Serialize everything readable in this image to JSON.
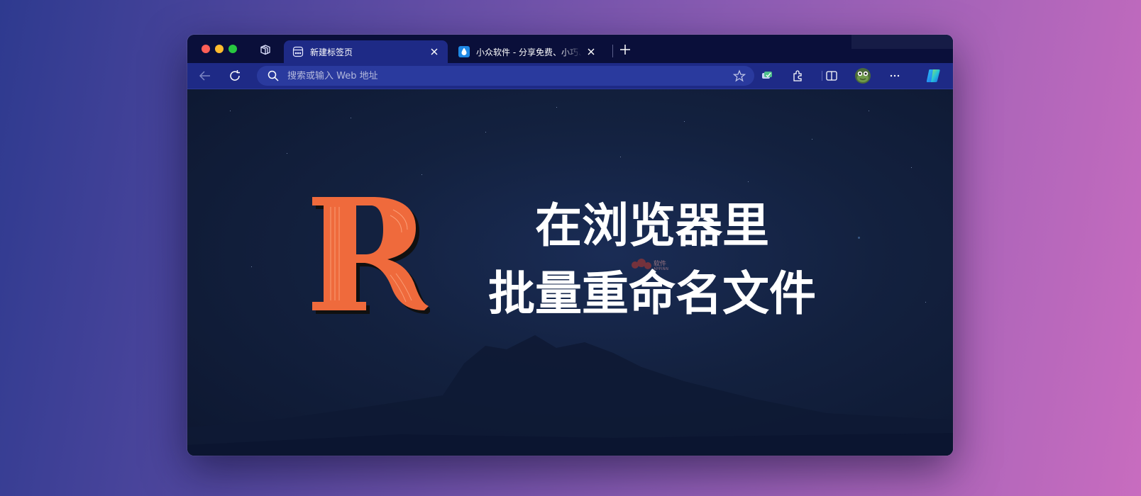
{
  "colors": {
    "titlebar_bg": "#0a0f3a",
    "toolbar_bg": "#1e2a86",
    "address_bar_bg": "#2a3a9e",
    "content_bg": "#13213f",
    "logo_r": "#ef6a3c"
  },
  "tabs": [
    {
      "title": "新建标签页",
      "icon": "new-tab-page-icon",
      "active": true
    },
    {
      "title": "小众软件 - 分享免费、小巧、实用",
      "icon": "water-drop-icon",
      "active": false
    }
  ],
  "address_bar": {
    "placeholder": "搜索或输入 Web 地址",
    "value": ""
  },
  "hero": {
    "logo_letter": "R",
    "line1": "在浏览器里",
    "line2": "批量重命名文件"
  },
  "watermark": {
    "text": "软件",
    "subtext": "APPINN"
  }
}
